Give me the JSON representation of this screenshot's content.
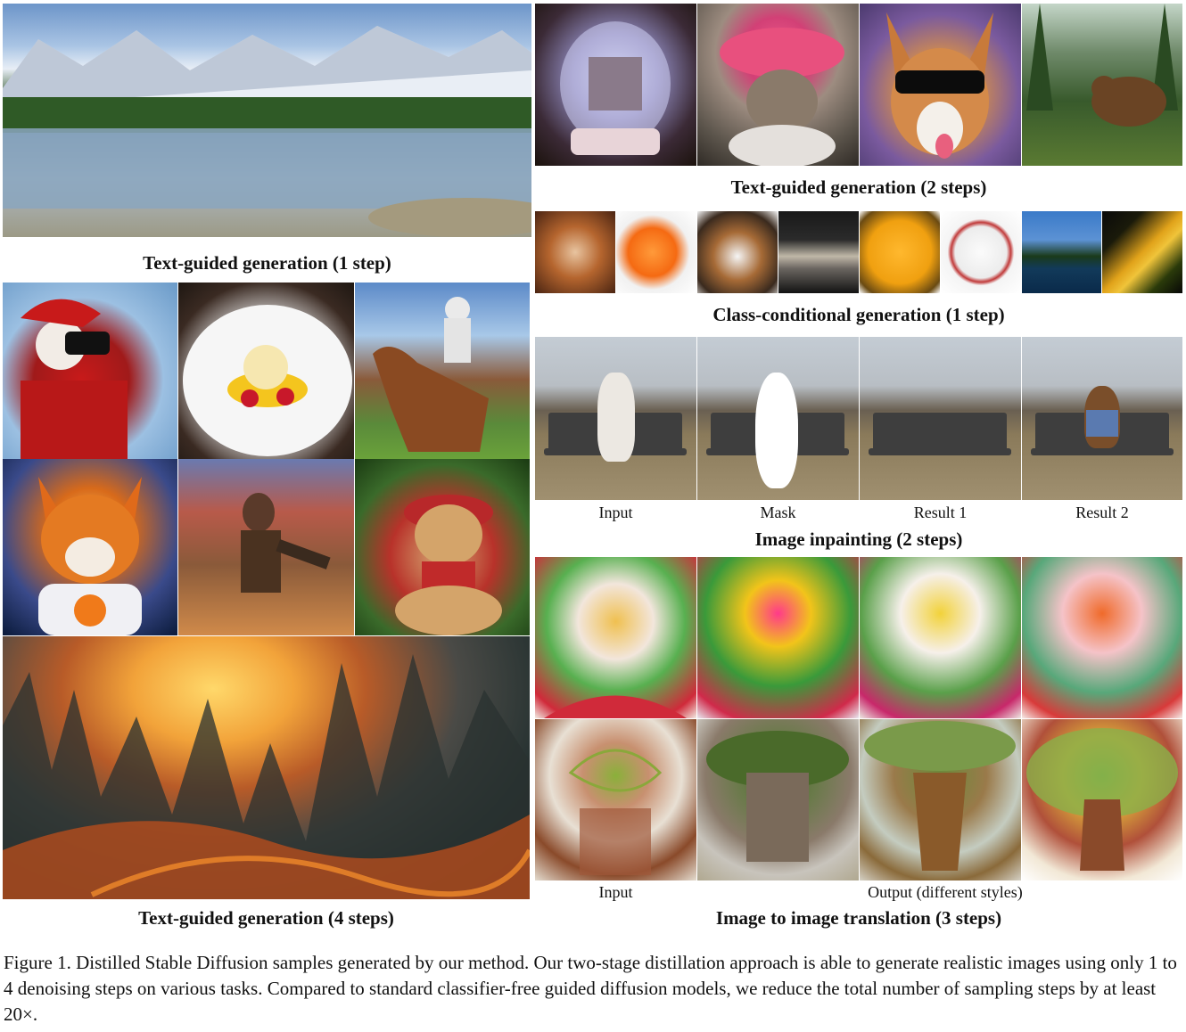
{
  "panels": {
    "text_1step": "Text-guided generation (1 step)",
    "text_2steps": "Text-guided generation (2 steps)",
    "class_cond": "Class-conditional generation (1 step)",
    "inpainting": "Image inpainting (2 steps)",
    "text_4steps": "Text-guided generation (4 steps)",
    "img2img": "Image to image translation (3 steps)"
  },
  "inpainting_labels": [
    "Input",
    "Mask",
    "Result 1",
    "Result 2"
  ],
  "img2img_labels": {
    "input": "Input",
    "output": "Output (different styles)"
  },
  "figure_caption": "Figure 1. Distilled Stable Diffusion samples generated by our method. Our two-stage distillation approach is able to generate realistic images using only 1 to 4 denoising steps on various tasks. Compared to standard classifier-free guided diffusion models, we reduce the total number of sampling steps by at least 20×."
}
